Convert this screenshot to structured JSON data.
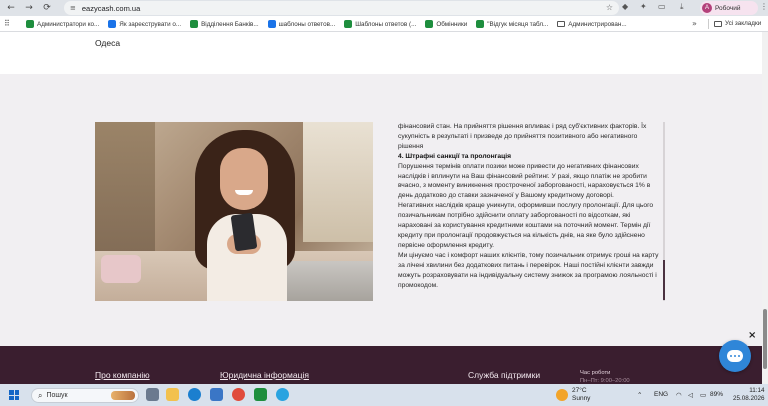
{
  "browser": {
    "url": "eazycash.com.ua",
    "profile_name": "Робочий",
    "profile_initial": "A",
    "bookmarks": [
      {
        "label": "Администратори ко...",
        "icon": "sheets-icon"
      },
      {
        "label": "Як зареєструвати о...",
        "icon": "docs-icon"
      },
      {
        "label": "Відділення Банків...",
        "icon": "sheets-icon"
      },
      {
        "label": "шаблоны ответов...",
        "icon": "docs-icon"
      },
      {
        "label": "Шаблоны ответов (...",
        "icon": "sheets-icon"
      },
      {
        "label": "Обмінники",
        "icon": "sheets-icon"
      },
      {
        "label": "\"Відгук місяця табл...",
        "icon": "sheets-icon"
      },
      {
        "label": "Администрирован...",
        "icon": "folder-icon"
      }
    ],
    "all_bookmarks": "Усі закладки"
  },
  "page": {
    "city": "Одеса",
    "article": {
      "para1": "фінансовий стан. На прийняття рішення впливає і ряд суб'єктивних факторів. Їх сукупність в результаті і призведе до прийняття позитивного або негативного рішення",
      "heading": "4. Штрафні санкції та пролонгація",
      "para2": "Порушення термінів оплати позики може привести до негативних фінансових наслідків і вплинути на Ваш фінансовий рейтинг. У разі, якщо платіж не зробити вчасно, з моменту виникнення простроченої заборгованості, нараховується 1% в день додатково до ставки зазначеної у Вашому кредитному договорі.",
      "para3": "Негативних наслідків краще уникнути, оформивши послугу пролонгації. Для цього позичальникам потрібно здійснити оплату заборгованості по відсоткам, які нараховані за користування кредитними коштами на поточний момент. Термін дії кредиту при пролонгації продовжується на кількість днів, на яке було здійснено первісне оформлення кредиту.",
      "para4": "Ми цінуємо час і комфорт наших клієнтів, тому позичальник отримує гроші на карту за лічені хвилини без додаткових питань і перевірок. Наші постійні клієнти завжди можуть розраховувати на індивідуальну систему знижок за програмою лояльності і промокодом."
    },
    "footer": {
      "about": "Про компанію",
      "legal": "Юридична інформація",
      "support": "Служба підтримки",
      "hours_label": "Час роботи",
      "hours_value": "Пн–Пт: 9:00–20:00"
    },
    "close_symbol": "×"
  },
  "taskbar": {
    "search_placeholder": "Пошук",
    "weather_temp": "27°C",
    "weather_desc": "Sunny",
    "lang": "ENG",
    "battery": "89%",
    "time": "11:14",
    "date": "25.08.2026"
  }
}
